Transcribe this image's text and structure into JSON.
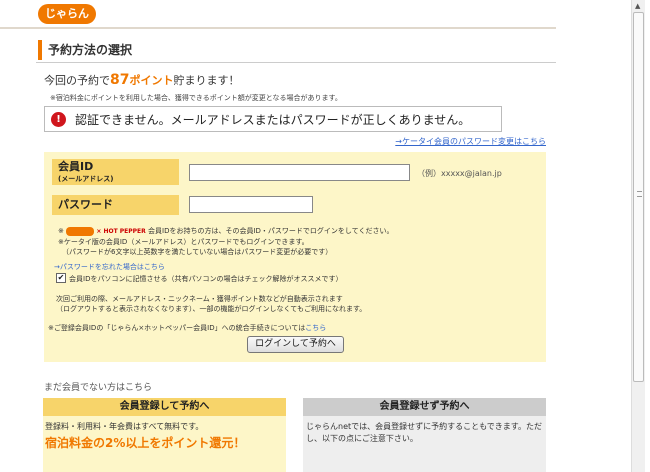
{
  "brand": {
    "logo_text": "じゃらん"
  },
  "page_title": "予約方法の選択",
  "points": {
    "prefix": "今回の予約で",
    "value": "87",
    "unit": "ポイント",
    "suffix": "貯まります！",
    "note": "※宿泊料金にポイントを利用した場合、獲得できるポイント額が変更となる場合があります。"
  },
  "error": {
    "icon": "!",
    "message": "認証できません。メールアドレスまたはパスワードが正しくありません。"
  },
  "ktai_link": "→ケータイ会員のパスワード変更はこちら",
  "form": {
    "id_label": "会員ID",
    "id_sublabel": "(メールアドレス)",
    "id_value": "",
    "id_example": "（例）xxxxx@jalan.jp",
    "pw_label": "パスワード",
    "pw_value": "",
    "notes": [
      "※",
      "× HOT PEPPER",
      "会員IDをお持ちの方は、その会員ID・パスワードでログインをしてください。",
      "※ケータイ版の会員ID（メールアドレス）とパスワードでもログインできます。",
      "（パスワードが6文字以上英数字を満たしていない場合はパスワード変更が必要です）"
    ],
    "forgot_link": "→パスワードを忘れた場合はこちら",
    "remember_checked": "✔",
    "remember_label": "会員IDをパソコンに記憶させる（共有パソコンの場合はチェック解除がオススメです）",
    "info_1": "次回ご利用の際、メールアドレス・ニックネーム・獲得ポイント数などが自動表示されます",
    "info_2": "（ログアウトすると表示されなくなります）、一部の機能がログインしなくてもご利用になれます。",
    "merge_prefix": "※ご登録会員IDの「じゃらん×ホットペッパー会員ID」への統合手続きについては",
    "merge_link": "こちら",
    "login_button": "ログインして予約へ"
  },
  "nonmember": {
    "title": "まだ会員でない方はこちら",
    "register": {
      "head": "会員登録して予約へ",
      "sub": "登録料・利用料・年会費はすべて無料です。",
      "promo": "宿泊料金の2%以上をポイント還元！"
    },
    "guest": {
      "head": "会員登録せず予約へ",
      "text": "じゃらんnetでは、会員登録せずに予約することもできます。ただし、以下の点にご注意下さい。"
    }
  },
  "colors": {
    "accent": "#f07800",
    "panel": "#fdf6c8",
    "label_bg": "#f7d46a",
    "link": "#3366cc",
    "error": "#d0161d"
  }
}
